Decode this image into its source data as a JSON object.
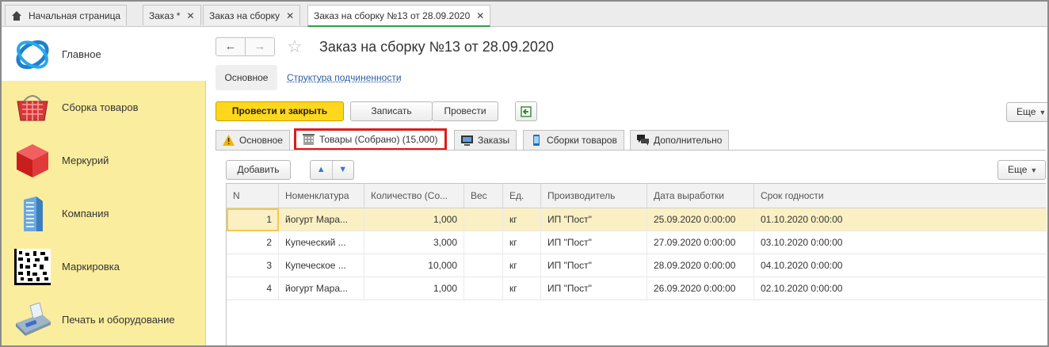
{
  "top_tabs": [
    {
      "label": "Начальная страница",
      "closable": false
    },
    {
      "label": "Заказ *",
      "closable": true
    },
    {
      "label": "Заказ на сборку",
      "closable": true
    },
    {
      "label": "Заказ на сборку №13 от 28.09.2020",
      "closable": true,
      "active": true
    }
  ],
  "close_glyph": "✕",
  "sidebar": {
    "items": [
      {
        "label": "Главное",
        "icon": "main-sections-icon",
        "active": true
      },
      {
        "label": "Сборка товаров",
        "icon": "basket-icon"
      },
      {
        "label": "Меркурий",
        "icon": "red-cube-icon"
      },
      {
        "label": "Компания",
        "icon": "building-icon"
      },
      {
        "label": "Маркировка",
        "icon": "datamatrix-code-icon"
      },
      {
        "label": "Печать и оборудование",
        "icon": "payment-terminal-icon"
      }
    ]
  },
  "header": {
    "title": "Заказ на сборку №13 от 28.09.2020",
    "back": "←",
    "forward": "→",
    "star": "☆"
  },
  "subnav": {
    "main": "Основное",
    "link": "Структура подчиненности"
  },
  "toolbar": {
    "post_and_close": "Провести и закрыть",
    "save": "Записать",
    "post": "Провести",
    "more": "Еще"
  },
  "form_tabs": [
    {
      "label": "Основное",
      "icon": "warning-icon"
    },
    {
      "label": "Товары (Собрано) (15,000)",
      "icon": "building-small-icon",
      "active": true
    },
    {
      "label": "Заказы",
      "icon": "monitor-icon"
    },
    {
      "label": "Сборки товаров",
      "icon": "phone-icon"
    },
    {
      "label": "Дополнительно",
      "icon": "chat-icon"
    }
  ],
  "table_toolbar": {
    "add": "Добавить",
    "up": "▲",
    "down": "▼",
    "more": "Еще"
  },
  "table": {
    "columns": [
      "N",
      "Номенклатура",
      "Количество (Со...",
      "Вес",
      "Ед.",
      "Производитель",
      "Дата выработки",
      "Срок годности"
    ],
    "rows": [
      {
        "n": "1",
        "item": "йогурт Мара...",
        "qty": "1,000",
        "weight": "",
        "unit": "кг",
        "maker": "ИП \"Пост\"",
        "made": "25.09.2020 0:00:00",
        "expires": "01.10.2020 0:00:00",
        "selected": true
      },
      {
        "n": "2",
        "item": "Купеческий ...",
        "qty": "3,000",
        "weight": "",
        "unit": "кг",
        "maker": "ИП \"Пост\"",
        "made": "27.09.2020 0:00:00",
        "expires": "03.10.2020 0:00:00"
      },
      {
        "n": "3",
        "item": "Купеческое ...",
        "qty": "10,000",
        "weight": "",
        "unit": "кг",
        "maker": "ИП \"Пост\"",
        "made": "28.09.2020 0:00:00",
        "expires": "04.10.2020 0:00:00"
      },
      {
        "n": "4",
        "item": "йогурт Мара...",
        "qty": "1,000",
        "weight": "",
        "unit": "кг",
        "maker": "ИП \"Пост\"",
        "made": "26.09.2020 0:00:00",
        "expires": "02.10.2020 0:00:00"
      }
    ]
  },
  "colors": {
    "sidebar_bg": "#fbed9e",
    "primary_button": "#ffd71d",
    "selected_row": "#fbefc4",
    "active_tab_highlight": "#e01a1a",
    "link": "#2d5fa6"
  }
}
